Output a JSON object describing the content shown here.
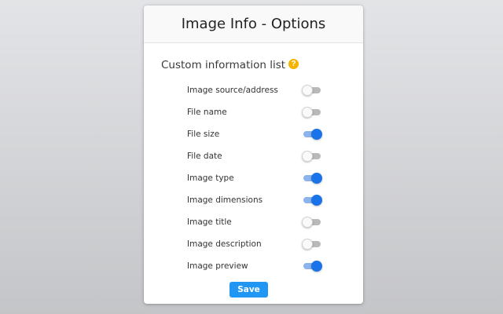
{
  "header": {
    "title": "Image Info - Options"
  },
  "section": {
    "title": "Custom information list",
    "help_icon_glyph": "?",
    "help_icon_color": "#f4b400"
  },
  "options": [
    {
      "label": "Image source/address",
      "enabled": false
    },
    {
      "label": "File name",
      "enabled": false
    },
    {
      "label": "File size",
      "enabled": true
    },
    {
      "label": "File date",
      "enabled": false
    },
    {
      "label": "Image type",
      "enabled": true
    },
    {
      "label": "Image dimensions",
      "enabled": true
    },
    {
      "label": "Image title",
      "enabled": false
    },
    {
      "label": "Image description",
      "enabled": false
    },
    {
      "label": "Image preview",
      "enabled": true
    }
  ],
  "save_label": "Save",
  "colors": {
    "toggle_on": "#1a73e8",
    "toggle_off": "#b9b9b9",
    "save_button": "#2196f3"
  }
}
